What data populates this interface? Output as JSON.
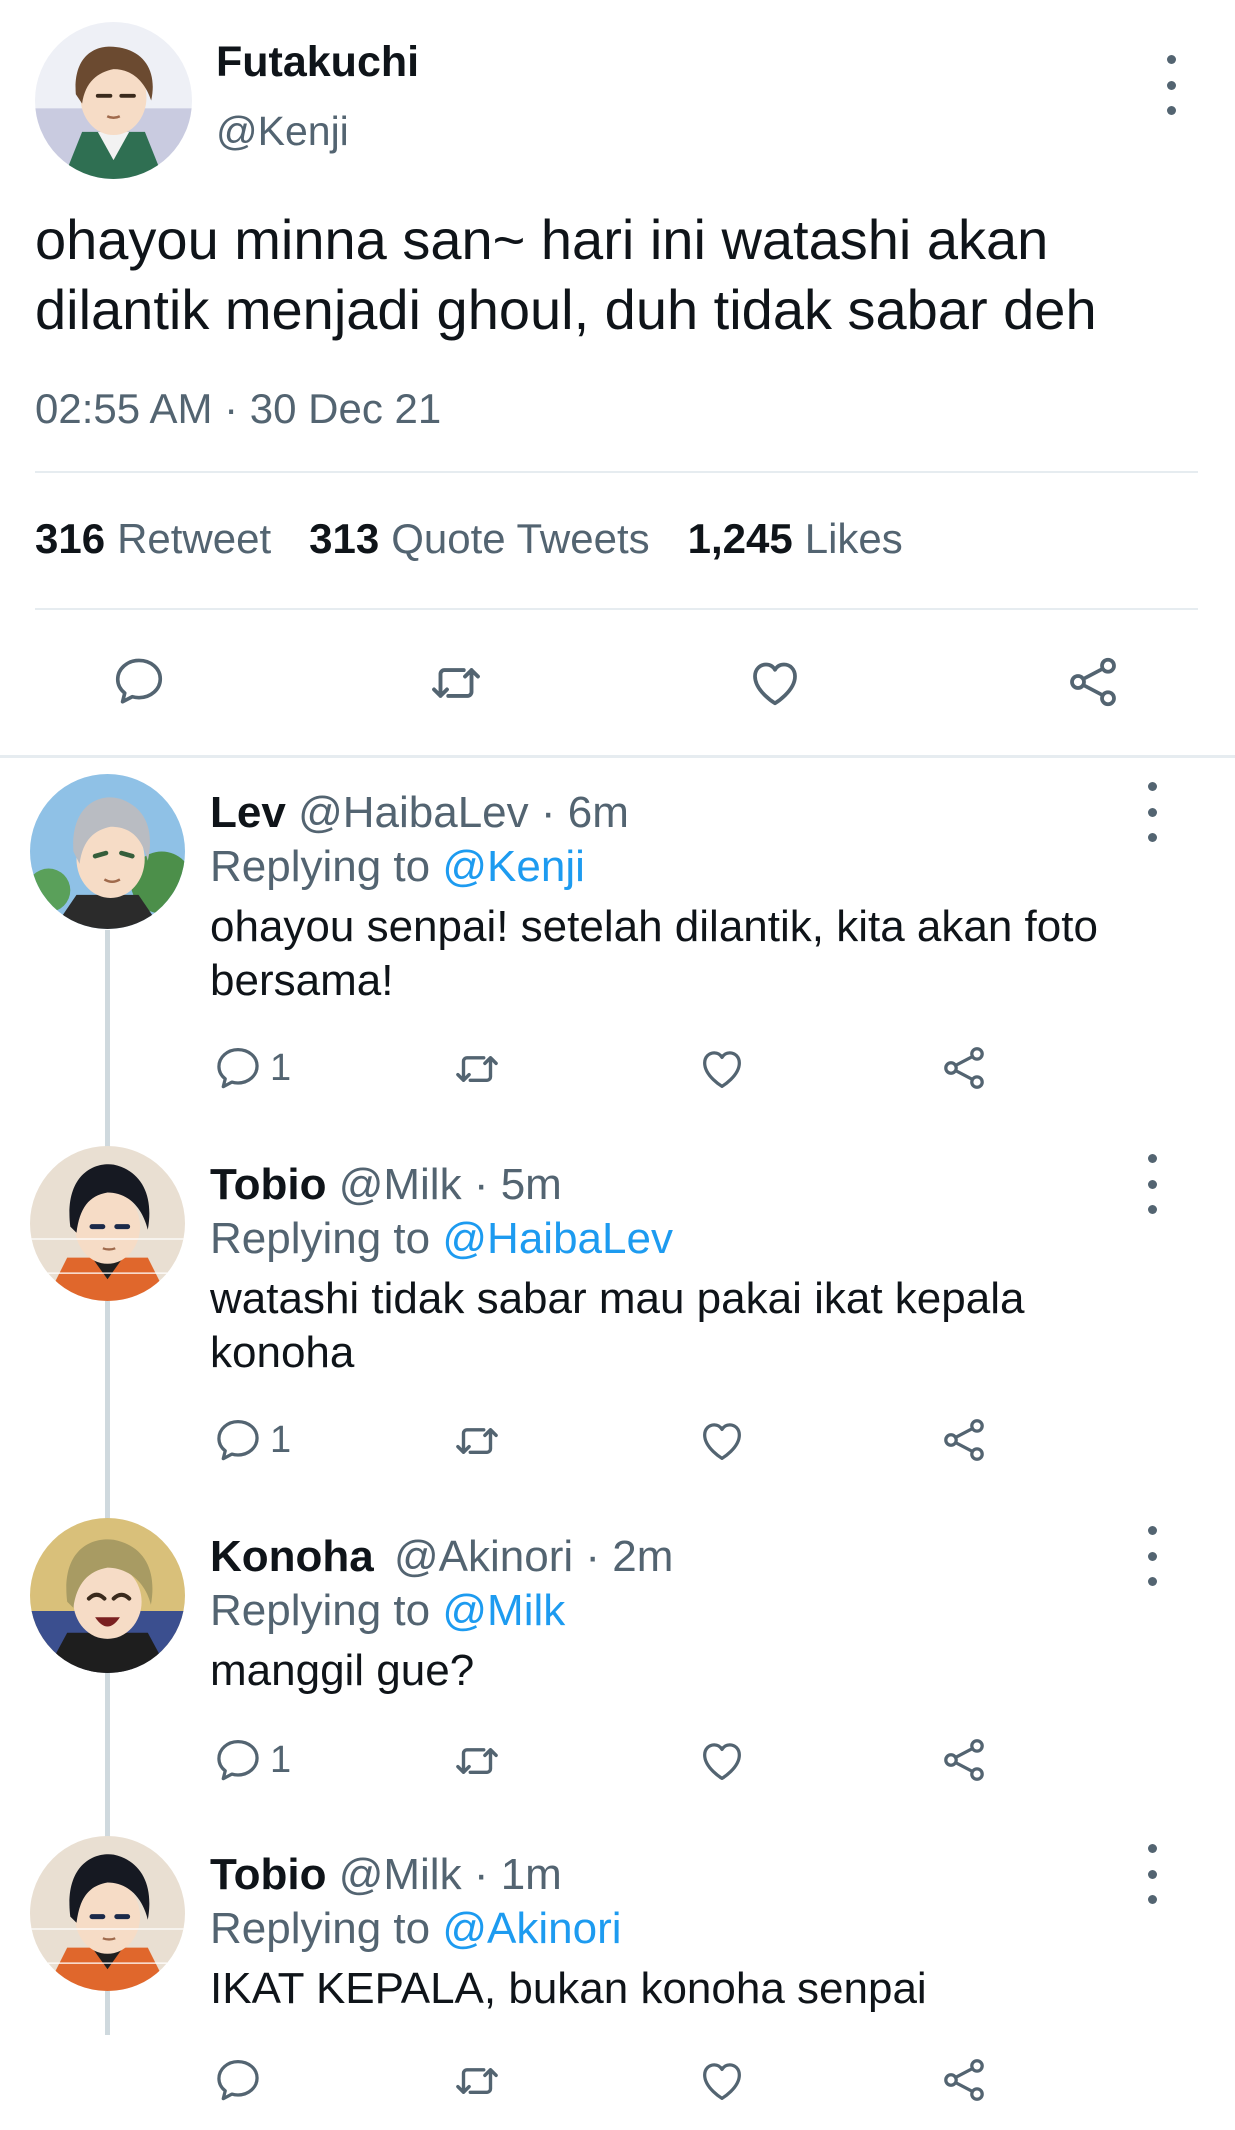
{
  "main_tweet": {
    "author_name": "Futakuchi",
    "author_handle": "@Kenji",
    "text": "ohayou minna san~ hari ini watashi akan dilantik menjadi ghoul, duh tidak sabar deh",
    "timestamp": "02:55 AM · 30 Dec 21",
    "stats": [
      {
        "value": "316",
        "label": "Retweet"
      },
      {
        "value": "313",
        "label": "Quote Tweets"
      },
      {
        "value": "1,245",
        "label": "Likes"
      }
    ],
    "actions": [
      "reply-icon",
      "retweet-icon",
      "like-icon",
      "share-icon"
    ]
  },
  "replies": [
    {
      "name": "Lev",
      "handle": "@HaibaLev",
      "time": "· 6m",
      "replying_prefix": "Replying to",
      "replying_to": "@Kenji",
      "text": "ohayou senpai! setelah dilantik, kita akan foto bersama!",
      "reply_count": "1"
    },
    {
      "name": "Tobio",
      "handle": "@Milk",
      "time": "· 5m",
      "replying_prefix": "Replying to",
      "replying_to": "@HaibaLev",
      "text": "watashi tidak sabar mau pakai ikat kepala konoha",
      "reply_count": "1"
    },
    {
      "name": "Konoha",
      "handle": "@Akinori",
      "time": "· 2m",
      "replying_prefix": "Replying to",
      "replying_to": "@Milk",
      "text": "manggil gue?",
      "reply_count": "1"
    },
    {
      "name": "Tobio",
      "handle": "@Milk",
      "time": "· 1m",
      "replying_prefix": "Replying to",
      "replying_to": "@Akinori",
      "text": "IKAT KEPALA, bukan konoha senpai",
      "reply_count": ""
    }
  ],
  "colors": {
    "text_primary": "#0f1419",
    "text_secondary": "#536471",
    "mention": "#1d9bf0",
    "divider": "#e6ecf0",
    "thread_line": "#cfd9de"
  }
}
